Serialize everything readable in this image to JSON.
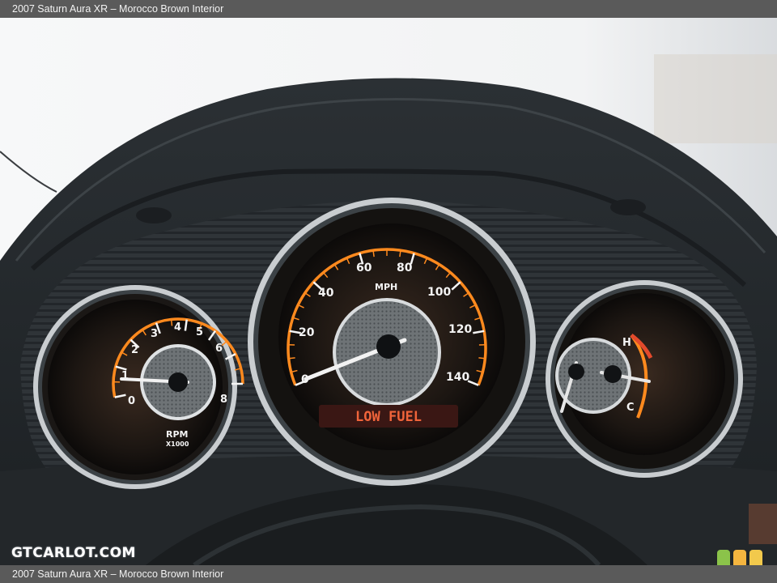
{
  "caption": {
    "top": "2007 Saturn Aura XR – Morocco Brown Interior",
    "bottom": "2007 Saturn Aura XR – Morocco Brown Interior"
  },
  "watermark": "GTCARLOT.COM",
  "tachometer": {
    "ticks": [
      "0",
      "1",
      "2",
      "3",
      "4",
      "5",
      "6",
      "8"
    ],
    "label": "RPM",
    "sublabel": "X1000"
  },
  "speedometer": {
    "ticks": [
      "0",
      "20",
      "40",
      "60",
      "80",
      "100",
      "120",
      "140"
    ],
    "unit": "MPH",
    "warning": "LOW FUEL"
  },
  "temperature": {
    "hot": "H",
    "cold": "C"
  },
  "colors": {
    "gauge_orange": "#ff8a1e",
    "warning_red": "#e34a2c",
    "chrome": "#d7dadd",
    "badge_green": "#8bc34a",
    "badge_orange": "#f5b53f",
    "badge_yellow": "#f2c94c"
  }
}
